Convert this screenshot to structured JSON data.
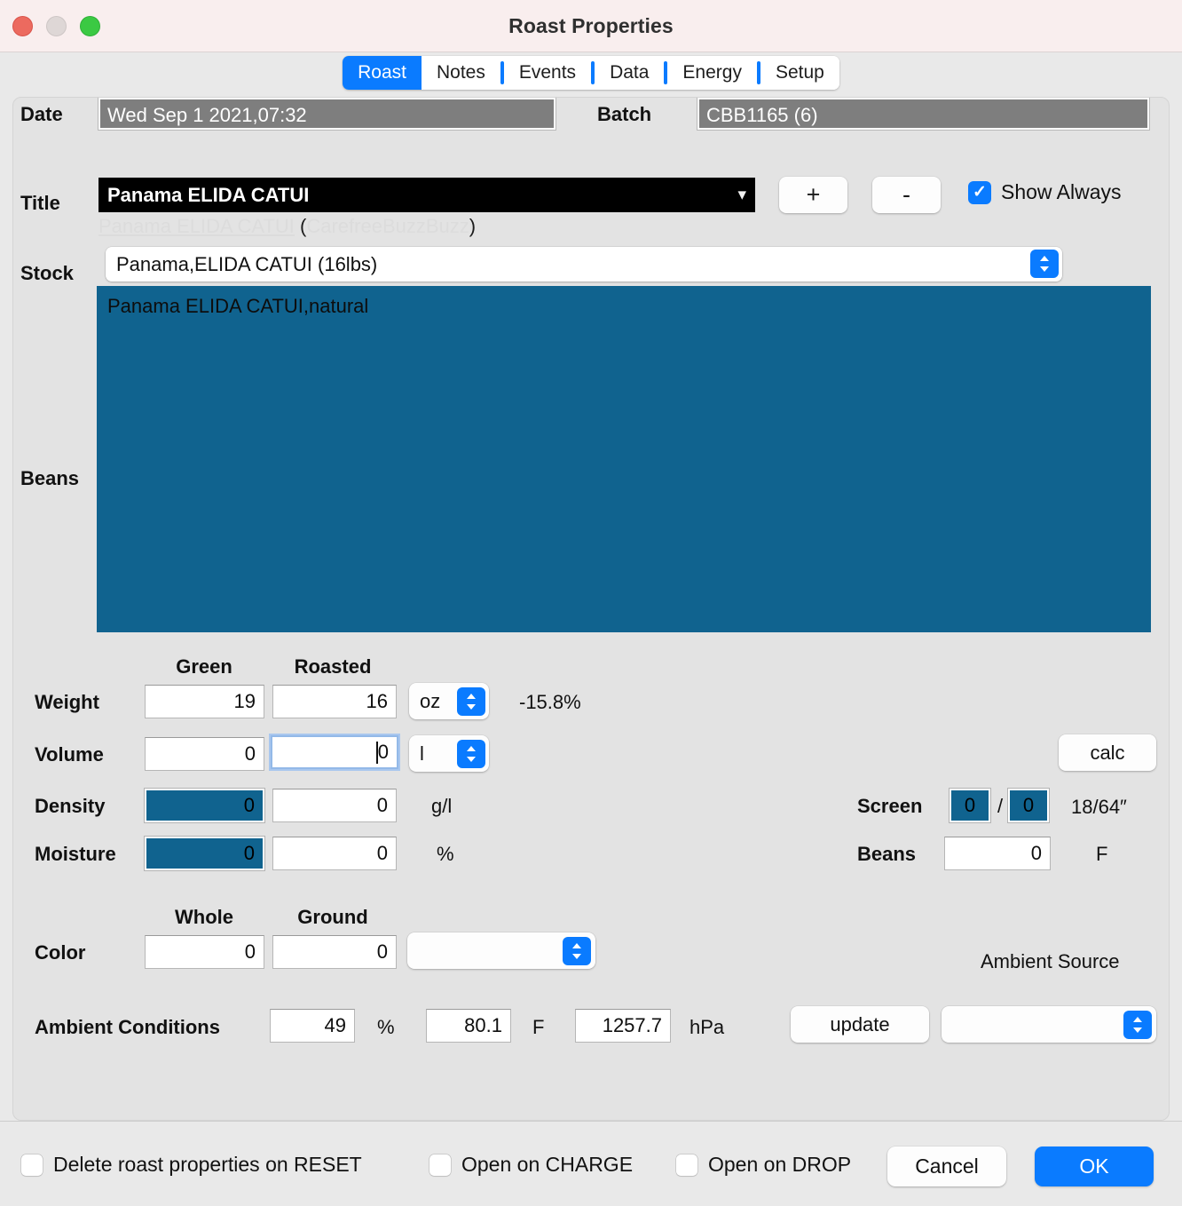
{
  "window": {
    "title": "Roast Properties",
    "traffic_lights": [
      "close-button",
      "minimize-button",
      "maximize-button"
    ]
  },
  "tabs": [
    {
      "label": "Roast",
      "active": true
    },
    {
      "label": "Notes",
      "active": false
    },
    {
      "label": "Events",
      "active": false
    },
    {
      "label": "Data",
      "active": false
    },
    {
      "label": "Energy",
      "active": false
    },
    {
      "label": "Setup",
      "active": false
    }
  ],
  "form": {
    "date_label": "Date",
    "date_value": "Wed Sep 1 2021,07:32",
    "batch_label": "Batch",
    "batch_value": "CBB1165 (6)",
    "title_label": "Title",
    "title_value": "Panama ELIDA CATUI",
    "title_chevron": "chevron-down-icon",
    "add_label": "+",
    "remove_label": "-",
    "show_always_label": "Show Always",
    "show_always_checked": true,
    "check_glyph": "✓",
    "link_name": "Panama ELIDA CATUI",
    "link_open_paren": "(",
    "link_user": "CarefreeBuzzBuzz",
    "link_close_paren": ")",
    "stock_label": "Stock",
    "stock_value": "Panama,ELIDA CATUI (16lbs)",
    "beans_label": "Beans",
    "beans_value": "Panama ELIDA CATUI,natural",
    "col_green": "Green",
    "col_roasted": "Roasted",
    "weight_label": "Weight",
    "weight_green": "19",
    "weight_roasted": "16",
    "weight_unit": "oz",
    "weight_loss": "-15.8%",
    "volume_label": "Volume",
    "volume_green": "0",
    "volume_roasted": "0",
    "volume_unit": "l",
    "calc_label": "calc",
    "density_label": "Density",
    "density_green": "0",
    "density_roasted": "0",
    "density_unit": "g/l",
    "moisture_label": "Moisture",
    "moisture_green": "0",
    "moisture_roasted": "0",
    "moisture_unit": "%",
    "screen_label": "Screen",
    "screen_min": "0",
    "screen_slash": "/",
    "screen_max": "0",
    "screen_unit": "18/64″",
    "beanstemp_label": "Beans",
    "beanstemp_value": "0",
    "beanstemp_unit": "F",
    "col_whole": "Whole",
    "col_ground": "Ground",
    "color_label": "Color",
    "color_whole": "0",
    "color_ground": "0",
    "color_system": "",
    "ambient_source_label": "Ambient Source",
    "ambient_conditions_label": "Ambient Conditions",
    "ambient_humidity": "49",
    "ambient_humidity_unit": "%",
    "ambient_temp": "80.1",
    "ambient_temp_unit": "F",
    "ambient_pressure": "1257.7",
    "ambient_pressure_unit": "hPa",
    "update_label": "update",
    "ambient_source_value": ""
  },
  "footer": {
    "delete_on_reset_label": "Delete roast properties on RESET",
    "delete_on_reset_checked": false,
    "open_on_charge_label": "Open on CHARGE",
    "open_on_charge_checked": false,
    "open_on_drop_label": "Open on DROP",
    "open_on_drop_checked": false,
    "cancel_label": "Cancel",
    "ok_label": "OK"
  },
  "colors": {
    "accent_blue": "#0a7bff",
    "field_teal": "#10638f",
    "readonly_gray": "#7e7e7e",
    "panel_bg": "#e3e3e3",
    "titlebar_bg": "#f9eeee"
  }
}
